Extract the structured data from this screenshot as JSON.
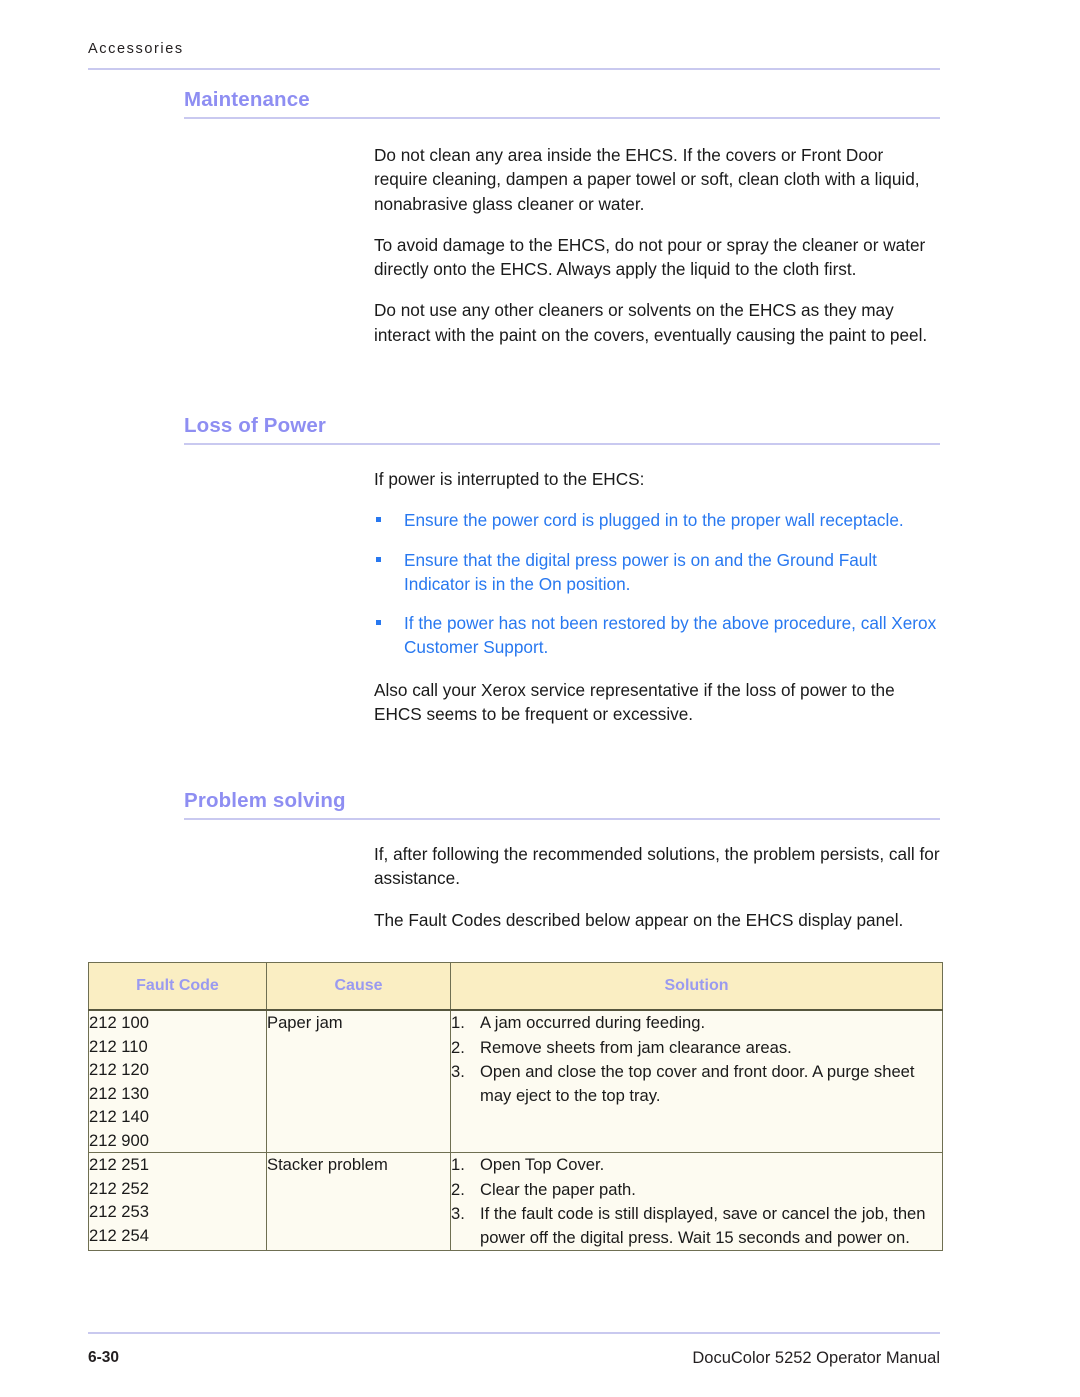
{
  "page": {
    "running_header": "Accessories",
    "footer_page_number": "6-30",
    "footer_manual_title": "DocuColor 5252 Operator Manual"
  },
  "sections": [
    {
      "id": "maintenance",
      "title": "Maintenance",
      "paragraphs": [
        "Do not clean any area inside the EHCS. If the covers or Front Door require cleaning, dampen a paper towel or soft, clean cloth with a liquid, nonabrasive glass cleaner or water.",
        "To avoid damage to the EHCS, do not pour or spray the cleaner or water directly onto the EHCS. Always apply the liquid to the cloth first.",
        "Do not use any other cleaners or solvents on the EHCS as they may interact with the paint on the covers, eventually causing the paint to peel."
      ]
    },
    {
      "id": "loss-of-power",
      "title": "Loss of Power",
      "intro": "If power is interrupted to the EHCS:",
      "bullets": [
        "Ensure the power cord is plugged in to the proper wall receptacle.",
        "Ensure that the digital press power is on and the Ground Fault Indicator is in the On position.",
        "If the power has not been restored by the above procedure, call Xerox Customer Support."
      ],
      "closing": "Also call your Xerox service representative if the loss of power to the EHCS seems to be frequent or excessive."
    },
    {
      "id": "problem-solving",
      "title": "Problem solving",
      "paragraphs": [
        "If, after following the recommended solutions, the problem persists, call for assistance.",
        "The Fault Codes described below appear on the EHCS display panel."
      ]
    }
  ],
  "fault_table": {
    "headers": [
      "Fault Code",
      "Cause",
      "Solution"
    ],
    "rows": [
      {
        "codes": [
          "212 100",
          "212 110",
          "212 120",
          "212 130",
          "212 140",
          "212 900"
        ],
        "cause": "Paper jam",
        "solutions": [
          "A jam occurred during feeding.",
          "Remove sheets from jam clearance areas.",
          "Open and close the top cover and front door. A purge sheet may eject to the top tray."
        ]
      },
      {
        "codes": [
          "212 251",
          "212 252",
          "212 253",
          "212 254"
        ],
        "cause": "Stacker problem",
        "solutions": [
          "Open Top Cover.",
          "Clear the paper path.",
          "If the fault code is still displayed, save or cancel the job, then power off the digital press. Wait 15 seconds and power on."
        ]
      }
    ]
  },
  "colors": {
    "heading_purple": "#8e8ef2",
    "bullet_blue": "#2878f0",
    "rule_lavender": "#c9c9ef",
    "table_header_bg": "#faeec3",
    "table_body_bg": "#fdfbf1",
    "table_border": "#6f6f52"
  }
}
